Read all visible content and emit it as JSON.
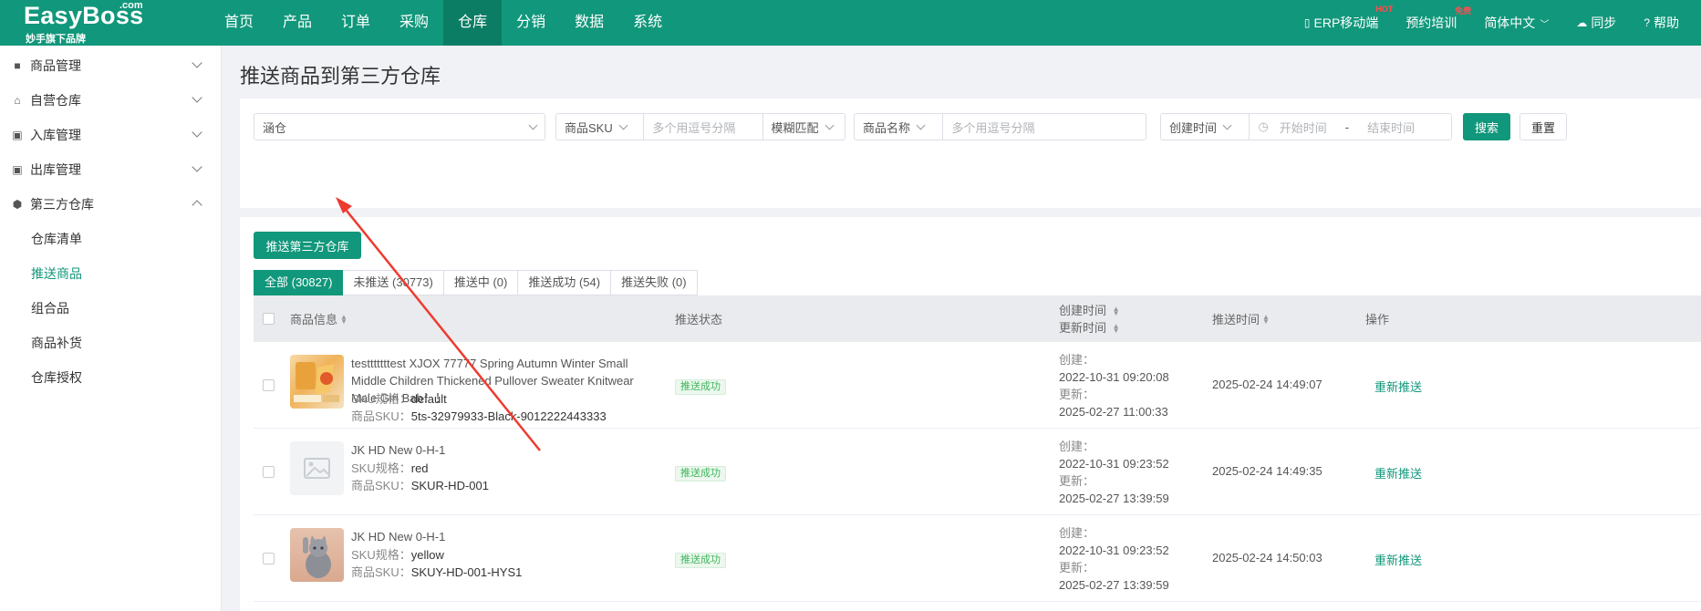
{
  "brand": {
    "name": "EasyBoss",
    "dotcom": ".com",
    "tagline": "妙手旗下品牌"
  },
  "nav": [
    "首页",
    "产品",
    "订单",
    "采购",
    "仓库",
    "分销",
    "数据",
    "系统"
  ],
  "top_right": {
    "erp": "ERP移动端",
    "erp_sup": "HOT",
    "training": "预约培训",
    "training_sup": "免费",
    "language": "简体中文",
    "sync": "同步",
    "help": "帮助"
  },
  "sidebar": {
    "groups": [
      {
        "label": "商品管理",
        "icon": "tag-icon"
      },
      {
        "label": "自营仓库",
        "icon": "home-icon"
      },
      {
        "label": "入库管理",
        "icon": "inbox-icon"
      },
      {
        "label": "出库管理",
        "icon": "outbox-icon"
      },
      {
        "label": "第三方仓库",
        "icon": "box-icon"
      }
    ],
    "sub_items": [
      "仓库清单",
      "推送商品",
      "组合品",
      "商品补货",
      "仓库授权"
    ]
  },
  "page_title": "推送商品到第三方仓库",
  "filters": {
    "warehouse_value": "涵仓",
    "sku_field": "商品SKU",
    "sku_placeholder": "多个用逗号分隔",
    "match_mode": "模糊匹配",
    "name_field": "商品名称",
    "name_placeholder": "多个用逗号分隔",
    "time_field": "创建时间",
    "start_placeholder": "开始时间",
    "date_sep": "-",
    "end_placeholder": "结束时间",
    "search": "搜索",
    "reset": "重置"
  },
  "push_button": "推送第三方仓库",
  "tabs": [
    "全部 (30827)",
    "未推送 (30773)",
    "推送中 (0)",
    "推送成功 (54)",
    "推送失败 (0)"
  ],
  "table": {
    "headers": {
      "product": "商品信息",
      "status": "推送状态",
      "created": "创建时间",
      "updated": "更新时间",
      "push_time": "推送时间",
      "action": "操作"
    },
    "labels": {
      "sku_spec": "SKU规格：",
      "sku_code": "商品SKU：",
      "created": "创建：",
      "updated": "更新："
    },
    "rows": [
      {
        "name": "testttttttest XJOX 77777 Spring Autumn Winter Small Middle Children Thickened Pullover Sweater Knitwear Male Girl Bab！！",
        "spec": "default",
        "sku": "5ts-32979933-Black-9012222443333",
        "status": "推送成功",
        "created": "2022-10-31 09:20:08",
        "updated": "2025-02-27 11:00:33",
        "push_time": "2025-02-24 14:49:07",
        "action": "重新推送"
      },
      {
        "name": "JK HD New 0-H-1",
        "spec": "red",
        "sku": "SKUR-HD-001",
        "status": "推送成功",
        "created": "2022-10-31 09:23:52",
        "updated": "2025-02-27 13:39:59",
        "push_time": "2025-02-24 14:49:35",
        "action": "重新推送"
      },
      {
        "name": "JK HD New 0-H-1",
        "spec": "yellow",
        "sku": "SKUY-HD-001-HYS1",
        "status": "推送成功",
        "created": "2022-10-31 09:23:52",
        "updated": "2025-02-27 13:39:59",
        "push_time": "2025-02-24 14:50:03",
        "action": "重新推送"
      }
    ]
  },
  "colors": {
    "primary": "#11977b",
    "annotation_arrow": "#ee3b2f"
  }
}
